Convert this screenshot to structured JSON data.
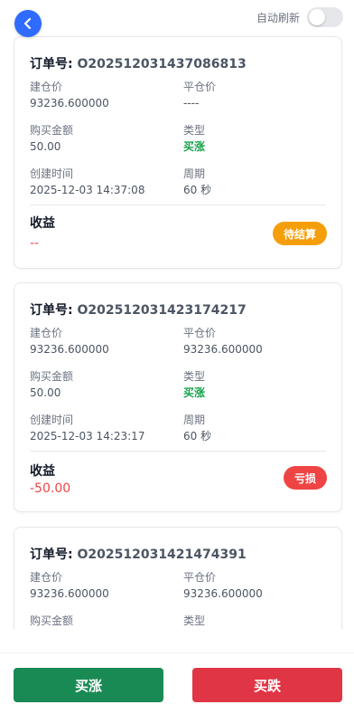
{
  "header": {
    "auto_refresh_label": "自动刷新",
    "auto_refresh_on": false
  },
  "labels": {
    "order_no": "订单号:",
    "open_price": "建仓价",
    "close_price": "平仓价",
    "amount": "购买金额",
    "type": "类型",
    "created": "创建时间",
    "period": "周期",
    "profit": "收益"
  },
  "orders": [
    {
      "order_id": "O202512031437086813",
      "open_price": "93236.600000",
      "close_price": "----",
      "amount": "50.00",
      "type": "买涨",
      "created": "2025-12-03 14:37:08",
      "period": "60 秒",
      "profit": "--",
      "status": "待结算"
    },
    {
      "order_id": "O202512031423174217",
      "open_price": "93236.600000",
      "close_price": "93236.600000",
      "amount": "50.00",
      "type": "买涨",
      "created": "2025-12-03 14:23:17",
      "period": "60 秒",
      "profit": "-50.00",
      "status": "亏损"
    },
    {
      "order_id": "O202512031421474391",
      "open_price": "93236.600000",
      "close_price": "93236.600000"
    }
  ],
  "actions": {
    "buy_up": "买涨",
    "buy_down": "买跌"
  },
  "colors": {
    "accent_blue": "#2f6bff",
    "up_green": "#16a34a",
    "buy_up_button": "#1a8a55",
    "buy_down_button": "#e03544",
    "pending_badge": "#f59e0b",
    "loss_red": "#ef4444"
  }
}
